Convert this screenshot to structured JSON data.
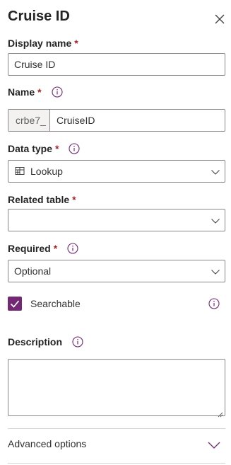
{
  "header": {
    "title": "Cruise ID",
    "close_icon": "close-icon"
  },
  "display_name": {
    "label": "Display name",
    "required_mark": "*",
    "value": "Cruise ID"
  },
  "name": {
    "label": "Name",
    "required_mark": "*",
    "prefix": "crbe7_",
    "value": "CruiseID"
  },
  "data_type": {
    "label": "Data type",
    "required_mark": "*",
    "selected": "Lookup",
    "icon": "table-icon"
  },
  "related_table": {
    "label": "Related table",
    "required_mark": "*",
    "selected": ""
  },
  "required": {
    "label": "Required",
    "required_mark": "*",
    "selected": "Optional"
  },
  "searchable": {
    "label": "Searchable",
    "checked": true
  },
  "description": {
    "label": "Description",
    "value": ""
  },
  "advanced": {
    "label": "Advanced options"
  },
  "colors": {
    "accent": "#742774",
    "required": "#a4262c",
    "border": "#8a8886"
  }
}
